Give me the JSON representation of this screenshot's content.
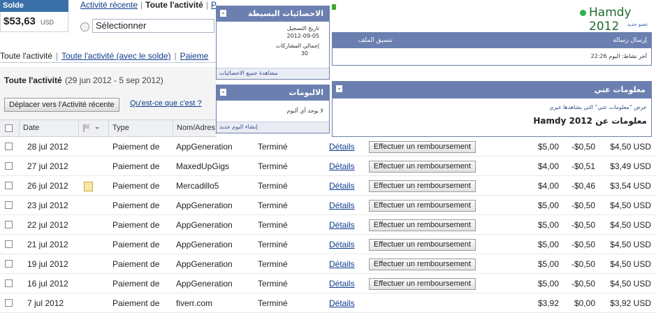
{
  "balance": {
    "label": "Solde",
    "amount": "$53,63",
    "currency": "USD"
  },
  "top_tabs": {
    "recent": "Activité récente",
    "all": "Toute l'activité",
    "cut": "P"
  },
  "select": {
    "value": "Sélectionner"
  },
  "second_tabs": {
    "all": "Toute l'activité",
    "with_balance": "Toute l'activité (avec le solde)",
    "payments": "Paieme"
  },
  "activity": {
    "title": "Toute l'activité",
    "range": "(29 jun 2012 - 5 sep 2012)"
  },
  "actions": {
    "move": "Déplacer vers l'Activité récente",
    "whatis": "Qu'est-ce que c'est ?"
  },
  "columns": {
    "date": "Date",
    "type": "Type",
    "name": "Nom/Adres"
  },
  "row_labels": {
    "details": "Détails",
    "refund": "Effectuer un remboursement"
  },
  "rows": [
    {
      "date": "28 jul 2012",
      "type": "Paiement de",
      "name": "AppGeneration",
      "status": "Terminé",
      "refund": true,
      "note": false,
      "gross": "$5,00",
      "fee": "-$0,50",
      "net": "$4,50 USD"
    },
    {
      "date": "27 jul 2012",
      "type": "Paiement de",
      "name": "MaxedUpGigs",
      "status": "Terminé",
      "refund": true,
      "note": false,
      "gross": "$4,00",
      "fee": "-$0,51",
      "net": "$3,49 USD"
    },
    {
      "date": "26 jul 2012",
      "type": "Paiement de",
      "name": "Mercadillo5",
      "status": "Terminé",
      "refund": true,
      "note": true,
      "gross": "$4,00",
      "fee": "-$0,46",
      "net": "$3,54 USD"
    },
    {
      "date": "23 jul 2012",
      "type": "Paiement de",
      "name": "AppGeneration",
      "status": "Terminé",
      "refund": true,
      "note": false,
      "gross": "$5,00",
      "fee": "-$0,50",
      "net": "$4,50 USD"
    },
    {
      "date": "22 jul 2012",
      "type": "Paiement de",
      "name": "AppGeneration",
      "status": "Terminé",
      "refund": true,
      "note": false,
      "gross": "$5,00",
      "fee": "-$0,50",
      "net": "$4,50 USD"
    },
    {
      "date": "21 jul 2012",
      "type": "Paiement de",
      "name": "AppGeneration",
      "status": "Terminé",
      "refund": true,
      "note": false,
      "gross": "$5,00",
      "fee": "-$0,50",
      "net": "$4,50 USD"
    },
    {
      "date": "19 jul 2012",
      "type": "Paiement de",
      "name": "AppGeneration",
      "status": "Terminé",
      "refund": true,
      "note": false,
      "gross": "$5,00",
      "fee": "-$0,50",
      "net": "$4,50 USD"
    },
    {
      "date": "16 jul 2012",
      "type": "Paiement de",
      "name": "AppGeneration",
      "status": "Terminé",
      "refund": true,
      "note": false,
      "gross": "$5,00",
      "fee": "-$0,50",
      "net": "$4,50 USD"
    },
    {
      "date": "7 jul 2012",
      "type": "Paiement de",
      "name": "fiverr.com",
      "status": "Terminé",
      "refund": false,
      "note": false,
      "gross": "$3,92",
      "fee": "$0,00",
      "net": "$3,92 USD"
    }
  ],
  "widgets": {
    "stats": {
      "title": "الاحصائيات البسيطة",
      "reg_label": "تاريخ التسجيل",
      "reg_value": "2012-09-05",
      "posts_label": "إجمالي المشاركات",
      "posts_value": "30",
      "footer": "مشاهدة جميع الاحصائيات",
      "toggle": "-"
    },
    "albums": {
      "title": "الالبومات",
      "body": "لا يوجد أي ألبوم",
      "footer": "إنشاء البوم جديد",
      "toggle": "-"
    },
    "actions": {
      "send": "إرسال رسالة",
      "format": "تنسيق الملف الشخصي",
      "last_active": "آخر نشاط: اليوم 22:26"
    },
    "about": {
      "title": "معلومات عني",
      "body": "عرض \"معلومات عني\" التي يشاهدها غيري",
      "heading": "معلومات عن Hamdy 2012",
      "toggle": "-"
    }
  },
  "profile": {
    "name": "Hamdy 2012",
    "subtitle": "عضو جديد"
  },
  "colors": {
    "accent_blue": "#3b6fa8",
    "widget_header": "#6b7fb1",
    "online_green": "#2bb34a"
  }
}
